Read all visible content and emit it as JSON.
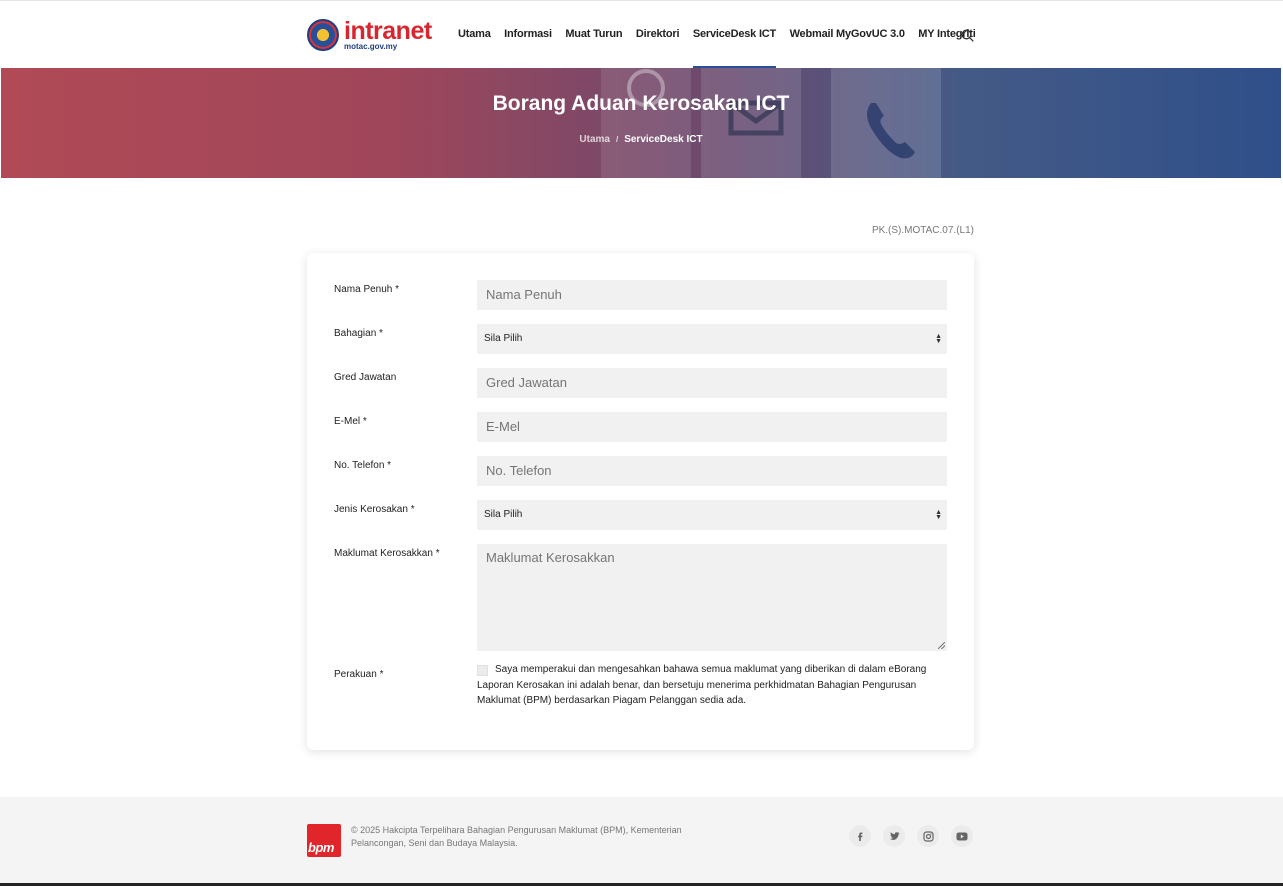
{
  "header": {
    "logo_text": "intranet",
    "logo_subtext": "motac.gov.my",
    "nav": [
      {
        "label": "Utama"
      },
      {
        "label": "Informasi"
      },
      {
        "label": "Muat Turun"
      },
      {
        "label": "Direktori"
      },
      {
        "label": "ServiceDesk ICT",
        "active": true
      },
      {
        "label": "Webmail MyGovUC 3.0"
      },
      {
        "label": "MY Integriti"
      }
    ],
    "search_icon": "search-icon"
  },
  "hero": {
    "title": "Borang Aduan Kerosakan ICT",
    "breadcrumb": {
      "home": "Utama",
      "separator": "/",
      "current": "ServiceDesk ICT"
    }
  },
  "form": {
    "code": "PK.(S).MOTAC.07.(L1)",
    "fields": {
      "nama": {
        "label": "Nama Penuh *",
        "placeholder": "Nama Penuh"
      },
      "bahagian": {
        "label": "Bahagian *",
        "value": "Sila Pilih"
      },
      "gred": {
        "label": "Gred Jawatan",
        "placeholder": "Gred Jawatan"
      },
      "emel": {
        "label": "E-Mel *",
        "placeholder": "E-Mel"
      },
      "telefon": {
        "label": "No. Telefon *",
        "placeholder": "No. Telefon"
      },
      "jenis": {
        "label": "Jenis Kerosakan *",
        "value": "Sila Pilih"
      },
      "maklumat": {
        "label": "Maklumat Kerosakkan *",
        "placeholder": "Maklumat Kerosakkan"
      },
      "perakuan": {
        "label": "Perakuan *",
        "text": "Saya memperakui dan mengesahkan bahawa semua maklumat yang diberikan di dalam eBorang Laporan Kerosakan ini adalah benar, dan bersetuju menerima perkhidmatan Bahagian Pengurusan Maklumat (BPM) berdasarkan Piagam Pelanggan sedia ada.",
        "checked": false
      }
    }
  },
  "footer": {
    "logo_text": "bpm",
    "copyright": "© 2025 Hakcipta Terpelihara Bahagian Pengurusan Maklumat (BPM), Kementerian Pelancongan, Seni dan Budaya Malaysia.",
    "social": [
      "facebook-icon",
      "twitter-icon",
      "instagram-icon",
      "youtube-icon"
    ]
  },
  "colors": {
    "accent": "#2a4f9a",
    "brand_red": "#d8262f",
    "field_bg": "#f1f1f1"
  }
}
